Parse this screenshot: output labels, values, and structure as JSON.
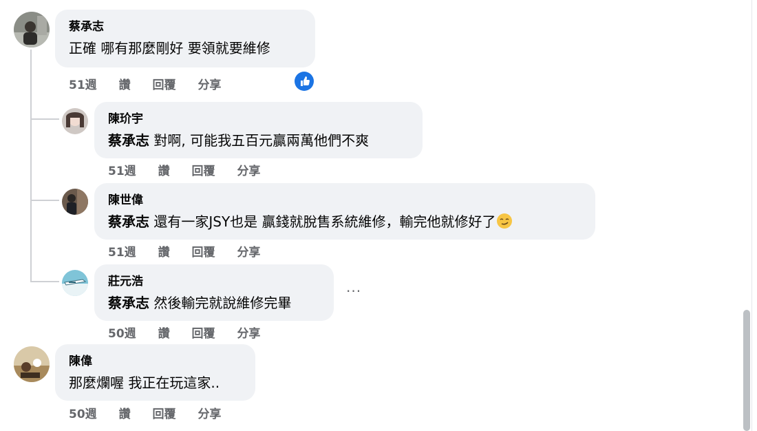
{
  "actions": {
    "like": "讚",
    "reply": "回覆",
    "share": "分享"
  },
  "icons": {
    "like_badge": "thumbs-up-icon",
    "more": "more-horizontal-icon",
    "emoji": "smirking-face-emoji"
  },
  "colors": {
    "bubble": "#f0f2f5",
    "meta_text": "#65676b",
    "like_blue": "#1b74e4",
    "thread_line": "#ced0d4"
  },
  "comments": [
    {
      "author": "蔡承志",
      "text": "正確 哪有那麼剛好 要領就要維修",
      "time": "51週",
      "reaction": "like"
    },
    {
      "author": "陳玠宇",
      "mention": "蔡承志",
      "text": "對啊, 可能我五百元贏兩萬他們不爽",
      "time": "51週"
    },
    {
      "author": "陳世偉",
      "mention": "蔡承志",
      "text": "還有一家JSY也是 贏錢就脫售系統維修，輸完他就修好了",
      "time": "51週",
      "emoji": "smirking-face"
    },
    {
      "author": "莊元浩",
      "mention": "蔡承志",
      "text": "然後輸完就說維修完畢",
      "time": "50週",
      "more": "···"
    },
    {
      "author": "陳偉",
      "text": "那麼爛喔 我正在玩這家..",
      "time": "50週"
    }
  ]
}
